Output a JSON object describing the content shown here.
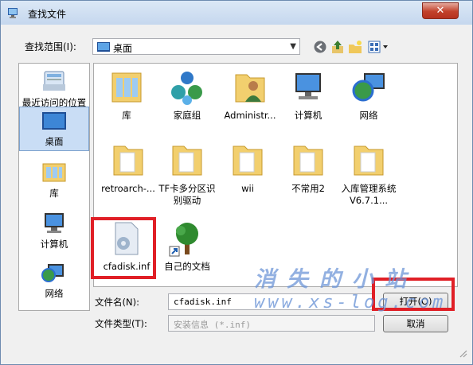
{
  "window": {
    "title": "查找文件",
    "close_glyph": "✕"
  },
  "lookin": {
    "label": "查找范围(I):",
    "value": "桌面",
    "arrow": "▼"
  },
  "sidebar": {
    "items": [
      {
        "label": "最近访问的位置",
        "icon": "recent-places-icon"
      },
      {
        "label": "桌面",
        "icon": "desktop-icon",
        "selected": true
      },
      {
        "label": "库",
        "icon": "libraries-icon"
      },
      {
        "label": "计算机",
        "icon": "computer-icon"
      },
      {
        "label": "网络",
        "icon": "network-icon"
      }
    ]
  },
  "files": [
    {
      "label": "库",
      "icon": "libraries-icon"
    },
    {
      "label": "家庭组",
      "icon": "homegroup-icon"
    },
    {
      "label": "Administr...",
      "icon": "user-folder-icon"
    },
    {
      "label": "计算机",
      "icon": "computer-icon"
    },
    {
      "label": "网络",
      "icon": "network-icon"
    },
    {
      "label": "retroarch-...",
      "icon": "folder-icon"
    },
    {
      "label": "TF卡多分区识别驱动",
      "icon": "folder-icon"
    },
    {
      "label": "wii",
      "icon": "folder-icon"
    },
    {
      "label": "不常用2",
      "icon": "folder-icon"
    },
    {
      "label": "入库管理系统 V6.7.1...",
      "icon": "folder-icon"
    },
    {
      "label": "cfadisk.inf",
      "icon": "inf-file-icon"
    },
    {
      "label": "自己的文档",
      "icon": "tree-shortcut-icon"
    }
  ],
  "filename": {
    "label": "文件名(N):",
    "value": "cfadisk.inf"
  },
  "filetype": {
    "label": "文件类型(T):",
    "value": "安装信息 (*.inf)"
  },
  "buttons": {
    "open": "打开(O)",
    "cancel": "取消"
  },
  "watermark": {
    "line1": "消失的小站",
    "line2": "www.xs-log.com"
  },
  "colors": {
    "highlight": "#e01f26",
    "selection": "#c9ddf5",
    "close": "#c2412b"
  }
}
